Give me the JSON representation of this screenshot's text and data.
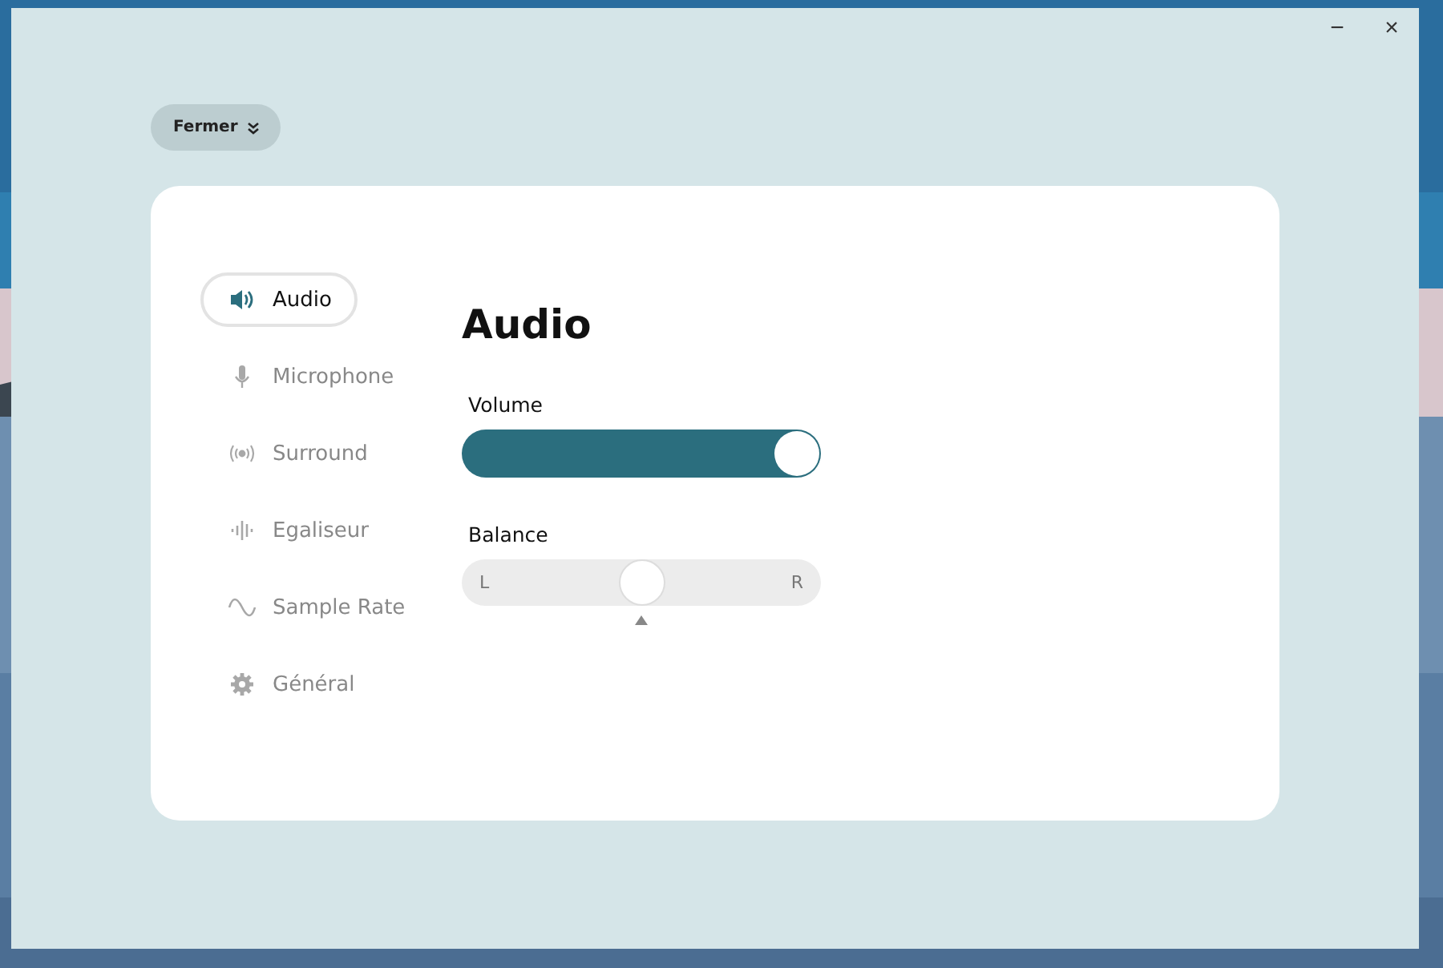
{
  "window": {
    "minimize": "−",
    "close": "×"
  },
  "close_button": {
    "label": "Fermer"
  },
  "sidebar": {
    "items": [
      {
        "label": "Audio",
        "kind": "speaker",
        "selected": true
      },
      {
        "label": "Microphone",
        "kind": "mic",
        "selected": false
      },
      {
        "label": "Surround",
        "kind": "surround",
        "selected": false
      },
      {
        "label": "Egaliseur",
        "kind": "eq",
        "selected": false
      },
      {
        "label": "Sample Rate",
        "kind": "wave",
        "selected": false
      },
      {
        "label": "Général",
        "kind": "gear",
        "selected": false
      }
    ]
  },
  "content": {
    "title": "Audio",
    "volume": {
      "label": "Volume",
      "level": 1.0
    },
    "balance": {
      "label": "Balance",
      "left": "L",
      "right": "R",
      "level": 0.5
    }
  }
}
